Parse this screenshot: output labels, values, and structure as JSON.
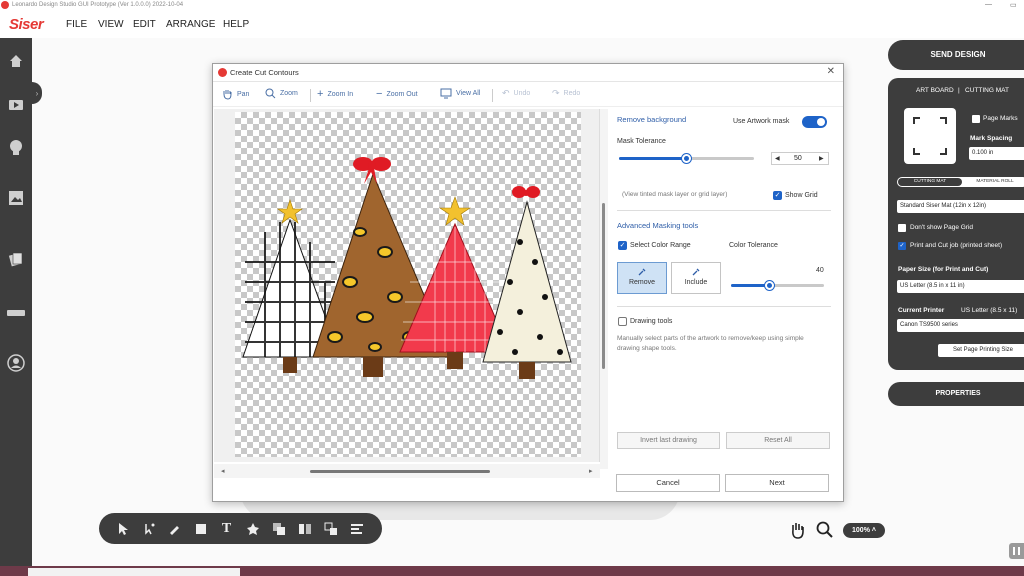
{
  "window": {
    "title": "Leonardo Design Studio GUI Prototype (Ver 1.0.0.0) 2022-10-04"
  },
  "menubar": {
    "brand": "Siser",
    "items": [
      "FILE",
      "VIEW",
      "EDIT",
      "ARRANGE",
      "HELP"
    ]
  },
  "left_sidebar": {
    "icons": [
      "home-icon",
      "video-icon",
      "lightbulb-icon",
      "image-icon",
      "layers-icon",
      "ruler-icon",
      "user-icon"
    ]
  },
  "dialog": {
    "title": "Create Cut Contours",
    "toolbar": {
      "pan": "Pan",
      "zoom": "Zoom",
      "zoom_in": "Zoom In",
      "zoom_out": "Zoom Out",
      "view_all": "View All",
      "undo": "Undo",
      "redo": "Redo"
    },
    "remove_background": {
      "title": "Remove background",
      "use_artwork_mask_label": "Use Artwork mask",
      "use_artwork_mask": true,
      "mask_tolerance_label": "Mask Tolerance",
      "mask_tolerance": "50",
      "note": "(View tinted mask layer or grid layer)",
      "show_grid_label": "Show Grid",
      "show_grid": true
    },
    "advanced": {
      "title": "Advanced Masking tools",
      "select_color_range_label": "Select Color Range",
      "select_color_range": true,
      "color_tolerance_label": "Color Tolerance",
      "color_tolerance": "40",
      "remove_label": "Remove",
      "include_label": "Include"
    },
    "drawing": {
      "drawing_tools_label": "Drawing tools",
      "description": "Manually select parts of the artwork to remove/keep using simple drawing shape tools.",
      "invert_label": "Invert last drawing",
      "reset_label": "Reset All"
    },
    "footer": {
      "cancel": "Cancel",
      "next": "Next"
    }
  },
  "right_panel": {
    "send_design": "SEND DESIGN",
    "art_board": "ART BOARD",
    "separator": "|",
    "cutting_mat": "CUTTING MAT",
    "page_marks": "Page Marks",
    "mark_spacing_label": "Mark Spacing",
    "mark_spacing": "0.100 in",
    "tab_cutting_mat": "CUTTING MAT",
    "tab_material_roll": "MATERIAL ROLL",
    "mat_select": "Standard Siser Mat (12in x 12in)",
    "dont_show_grid": "Don't show Page Grid",
    "print_and_cut": "Print and Cut job (printed sheet)",
    "paper_size_label": "Paper Size (for Print and Cut)",
    "paper_size": "US Letter (8.5 in x 11 in)",
    "current_printer_label": "Current Printer",
    "current_printer_paper": "US Letter (8.5 x 11)",
    "printer": "Canon TS9500 series",
    "set_page_size": "Set Page Printing Size",
    "properties": "PROPERTIES"
  },
  "bottom_bar": {
    "zoom_level": "100%"
  },
  "colors": {
    "accent": "#1e63c8",
    "brand": "#e53935",
    "dark_panel": "#3d3d3d"
  }
}
